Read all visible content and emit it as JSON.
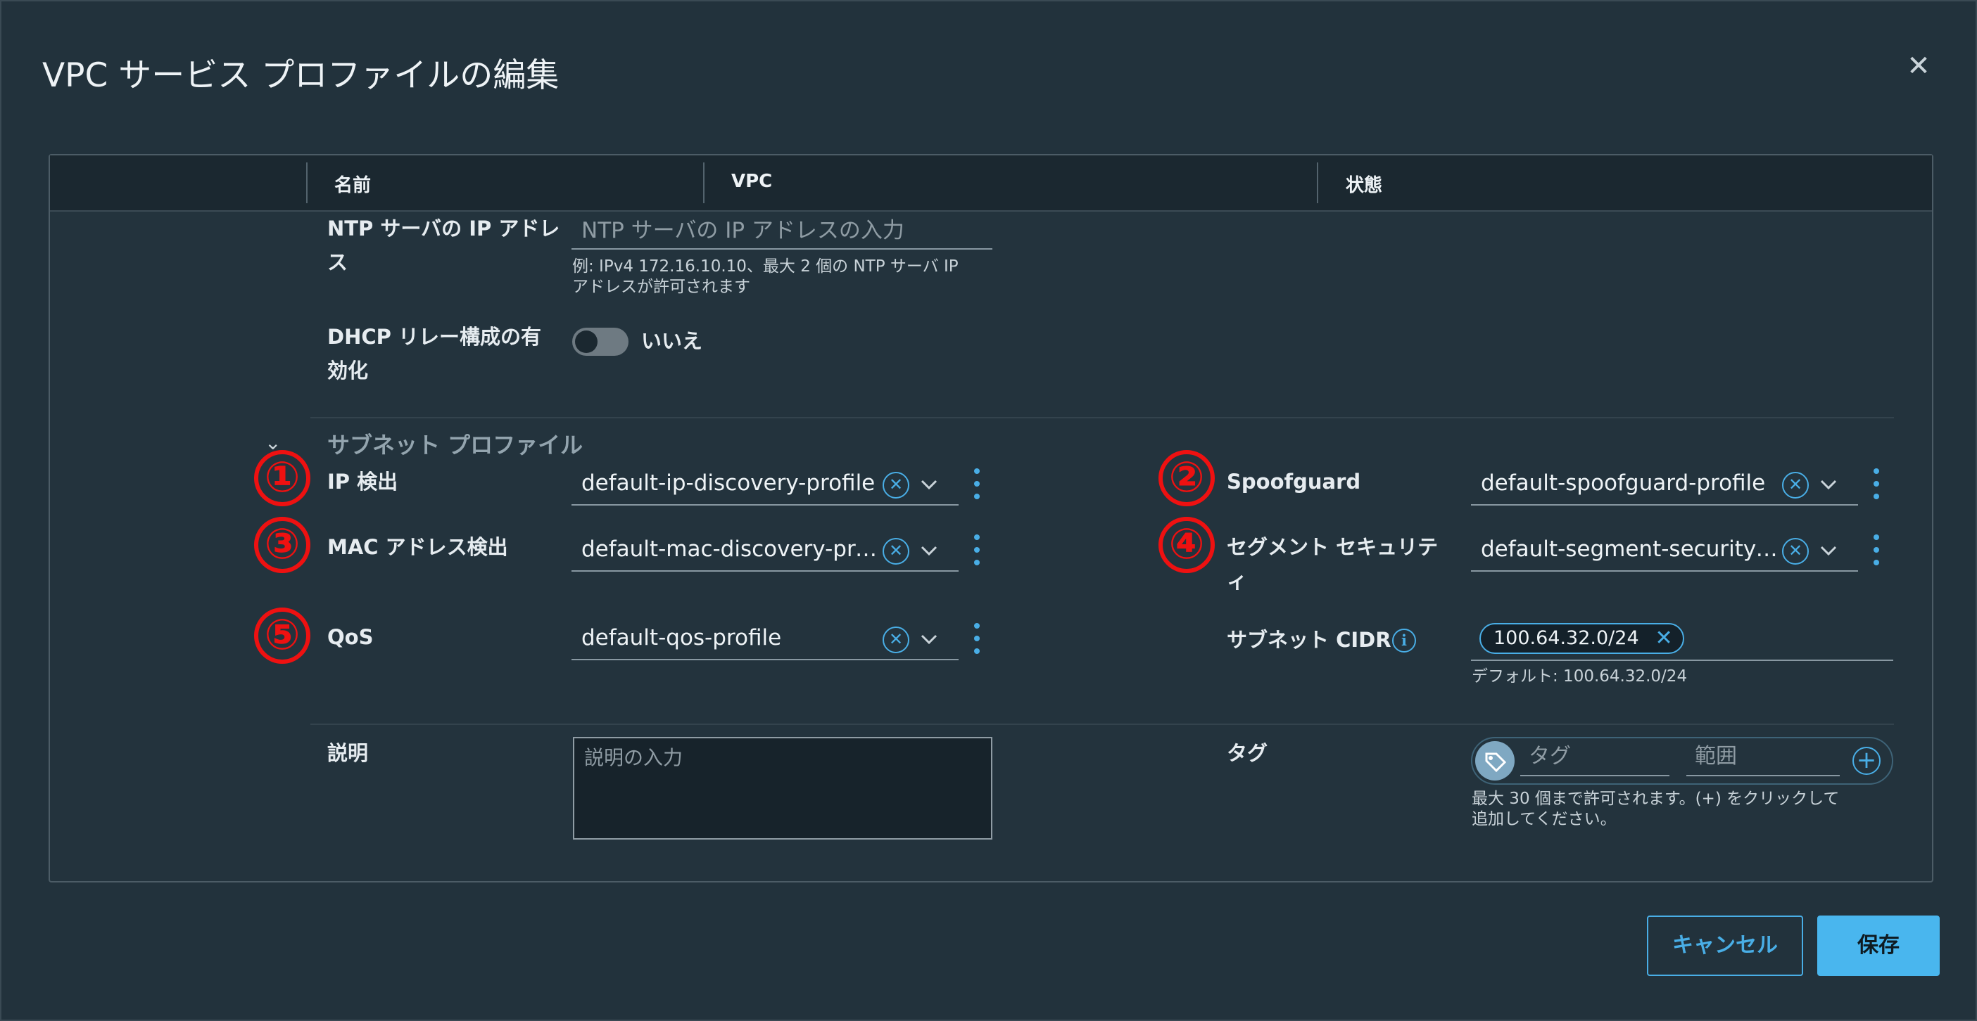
{
  "dialog": {
    "title": "VPC サービス プロファイルの編集",
    "close_icon": "close-icon"
  },
  "table_header": {
    "col_name": "名前",
    "col_vpc": "VPC",
    "col_state": "状態"
  },
  "ntp": {
    "label_line1": "NTP サーバの IP アドレ",
    "label_line2": "ス",
    "placeholder": "NTP サーバの IP アドレスの入力",
    "hint_line1": "例: IPv4 172.16.10.10、最大 2 個の NTP サーバ IP",
    "hint_line2": "アドレスが許可されます"
  },
  "dhcp_relay": {
    "label_line1": "DHCP リレー構成の有",
    "label_line2": "効化",
    "state": "いいえ",
    "enabled": false
  },
  "subnet_profiles": {
    "section_title": "サブネット プロファイル",
    "ip_discovery": {
      "marker": "①",
      "label": "IP 検出",
      "value": "default-ip-discovery-profile"
    },
    "spoofguard": {
      "marker": "②",
      "label": "Spoofguard",
      "value": "default-spoofguard-profile"
    },
    "mac_discovery": {
      "marker": "③",
      "label": "MAC アドレス検出",
      "value": "default-mac-discovery-profile"
    },
    "segment_security": {
      "marker": "④",
      "label_line1": "セグメント セキュリテ",
      "label_line2": "ィ",
      "value": "default-segment-security-profile"
    },
    "qos": {
      "marker": "⑤",
      "label": "QoS",
      "value": "default-qos-profile"
    },
    "subnet_cidr": {
      "label": "サブネット CIDR",
      "chip": "100.64.32.0/24",
      "hint": "デフォルト: 100.64.32.0/24"
    }
  },
  "description": {
    "label": "説明",
    "placeholder": "説明の入力"
  },
  "tags": {
    "label": "タグ",
    "tag_placeholder": "タグ",
    "scope_placeholder": "範囲",
    "hint_line1": "最大 30 個まで許可されます。(+) をクリックして",
    "hint_line2": "追加してください。"
  },
  "footer": {
    "cancel_label": "キャンセル",
    "save_label": "保存"
  },
  "colors": {
    "accent": "#49b6ee",
    "annotation": "#ee1111",
    "background": "#22323c"
  }
}
